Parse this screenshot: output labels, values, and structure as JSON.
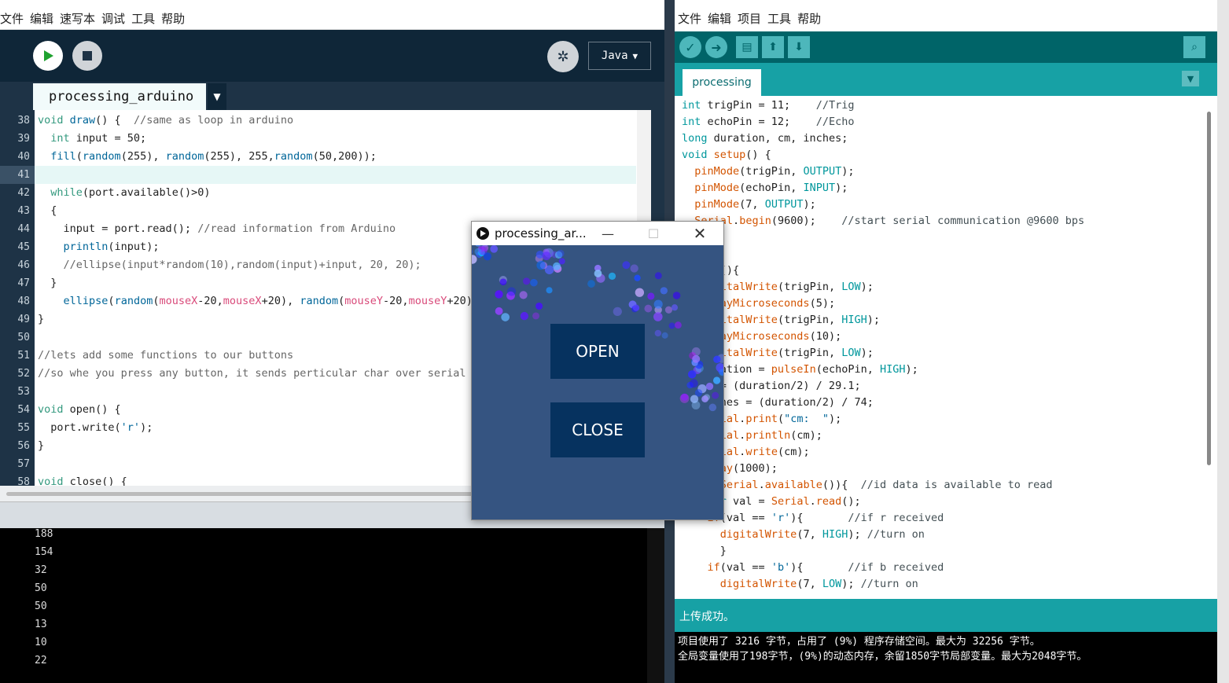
{
  "processing": {
    "menu": [
      "文件",
      "编辑",
      "速写本",
      "调试",
      "工具",
      "帮助"
    ],
    "mode_label": "Java",
    "tab_label": "processing_arduino",
    "code": [
      {
        "n": "38",
        "html": "<span class='kw'>void</span> <span class='fn'>draw</span>() {  <span class='cm'>//same as loop in arduino</span>"
      },
      {
        "n": "39",
        "html": "  <span class='kw'>int</span> input = 50;"
      },
      {
        "n": "40",
        "html": "  <span class='fn'>fill</span>(<span class='fn'>random</span>(255), <span class='fn'>random</span>(255), 255,<span class='fn'>random</span>(50,200));"
      },
      {
        "n": "41",
        "html": ""
      },
      {
        "n": "42",
        "html": "  <span class='kw'>while</span>(port.available()&gt;0)"
      },
      {
        "n": "43",
        "html": "  {"
      },
      {
        "n": "44",
        "html": "    input = port.read(); <span class='cm'>//read information from Arduino</span>"
      },
      {
        "n": "45",
        "html": "    <span class='fn'>println</span>(input);"
      },
      {
        "n": "46",
        "html": "    <span class='cm'>//ellipse(input*random(10),random(input)+input, 20, 20);</span>"
      },
      {
        "n": "47",
        "html": "  }"
      },
      {
        "n": "48",
        "html": "    <span class='fn'>ellipse</span>(<span class='fn'>random</span>(<span class='pink'>mouseX</span>-20,<span class='pink'>mouseX</span>+20), <span class='fn'>random</span>(<span class='pink'>mouseY</span>-20,<span class='pink'>mouseY</span>+20), 20, 20);"
      },
      {
        "n": "49",
        "html": "}"
      },
      {
        "n": "50",
        "html": ""
      },
      {
        "n": "51",
        "html": "<span class='cm'>//lets add some functions to our buttons</span>"
      },
      {
        "n": "52",
        "html": "<span class='cm'>//so whe you press any button, it sends perticular char over serial port</span>"
      },
      {
        "n": "53",
        "html": ""
      },
      {
        "n": "54",
        "html": "<span class='kw'>void</span> open() {"
      },
      {
        "n": "55",
        "html": "  port.write(<span class='fn'>'r'</span>);"
      },
      {
        "n": "56",
        "html": "}"
      },
      {
        "n": "57",
        "html": ""
      },
      {
        "n": "58",
        "html": "<span class='kw'>void</span> close() {"
      }
    ],
    "console": [
      "188",
      "154",
      "32",
      "50",
      "50",
      "13",
      "10",
      "22"
    ]
  },
  "sketch": {
    "title": "processing_ar...",
    "open_label": "OPEN",
    "close_label": "CLOSE"
  },
  "arduino": {
    "menu": [
      "文件",
      "编辑",
      "项目",
      "工具",
      "帮助"
    ],
    "tab_label": "processing",
    "code": [
      "<span class='at'>int</span> trigPin = 11;    <span class='ac'>//Trig</span>",
      "<span class='at'>int</span> echoPin = 12;    <span class='ac'>//Echo</span>",
      "<span class='at'>long</span> duration, cm, inches;",
      "<span class='at'>void</span> <span class='ao'>setup</span>() {",
      "  <span class='ao'>pinMode</span>(trigPin, <span class='at'>OUTPUT</span>);",
      "  <span class='ao'>pinMode</span>(echoPin, <span class='at'>INPUT</span>);",
      "  <span class='ao'>pinMode</span>(7, <span class='at'>OUTPUT</span>);",
      "  <span class='ao'>Serial</span>.<span class='ao'>begin</span>(9600);    <span class='ac'>//start serial communication @9600 bps</span>",
      "",
      "",
      "  <span class='ao'>loop</span>(){",
      "   <span class='ao'>digitalWrite</span>(trigPin, <span class='at'>LOW</span>);",
      "   <span class='ao'>delayMicroseconds</span>(5);",
      "   <span class='ao'>digitalWrite</span>(trigPin, <span class='at'>HIGH</span>);",
      "   <span class='ao'>delayMicroseconds</span>(10);",
      "   <span class='ao'>digitalWrite</span>(trigPin, <span class='at'>LOW</span>);",
      "   duration = <span class='ao'>pulseIn</span>(echoPin, <span class='at'>HIGH</span>);",
      "   cm = (duration/2) / 29.1;",
      "   inches = (duration/2) / 74;",
      "   <span class='ao'>Serial</span>.<span class='ao'>print</span>(<span class='fn'>\"cm:  \"</span>);",
      "   <span class='ao'>Serial</span>.<span class='ao'>println</span>(cm);",
      "   <span class='ao'>Serial</span>.<span class='ao'>write</span>(cm);",
      "   <span class='ao'>delay</span>(1000);",
      "   <span class='ao'>if</span>(<span class='ao'>Serial</span>.<span class='ao'>available</span>()){  <span class='ac'>//id data is available to read</span>",
      "   <span class='at'>char</span> val = <span class='ao'>Serial</span>.<span class='ao'>read</span>();",
      "    <span class='ao'>if</span>(val == <span class='fn'>'r'</span>){       <span class='ac'>//if r received</span>",
      "      <span class='ao'>digitalWrite</span>(7, <span class='at'>HIGH</span>); <span class='ac'>//turn on</span>",
      "      }",
      "    <span class='ao'>if</span>(val == <span class='fn'>'b'</span>){       <span class='ac'>//if b received</span>",
      "      <span class='ao'>digitalWrite</span>(7, <span class='at'>LOW</span>); <span class='ac'>//turn on</span>"
    ],
    "status": "上传成功。",
    "console": [
      "项目使用了 3216 字节，占用了 (9%) 程序存储空间。最大为 32256 字节。",
      "全局变量使用了198字节，(9%)的动态内存，余留1850字节局部变量。最大为2048字节。"
    ]
  },
  "colors": {
    "processing_bg": "#1e3346",
    "arduino_teal": "#17a1a5",
    "sketch_bg": "#355481",
    "sketch_button": "#06325f"
  }
}
